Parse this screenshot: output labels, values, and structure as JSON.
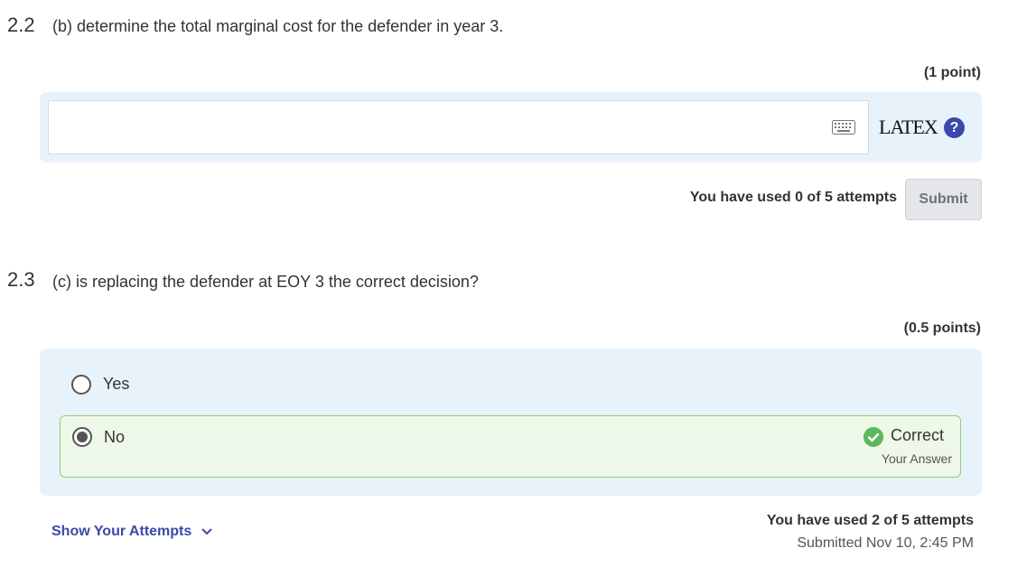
{
  "q22": {
    "number": "2.2",
    "text": "(b) determine the total marginal cost for the defender in year 3.",
    "points": "(1 point)",
    "input_value": "",
    "latex_label": "LATEX",
    "attempts_text": "You have used 0 of 5 attempts",
    "submit_label": "Submit"
  },
  "q23": {
    "number": "2.3",
    "text": "(c) is replacing the defender at EOY 3 the correct decision?",
    "points": "(0.5 points)",
    "options": [
      {
        "label": "Yes",
        "selected": false
      },
      {
        "label": "No",
        "selected": true
      }
    ],
    "result_label": "Correct",
    "result_sub": "Your Answer",
    "show_attempts_label": "Show Your Attempts",
    "attempts_text": "You have used 2 of 5 attempts",
    "submitted_text": "Submitted Nov 10, 2:45 PM"
  },
  "colors": {
    "panel_bg": "#e8f2fb",
    "correct_bg": "#eef8e8",
    "correct_border": "#8fcf6d",
    "check_green": "#5cb85c",
    "link_blue": "#3949ab"
  },
  "icons": {
    "keyboard": "keyboard-icon",
    "help": "help-icon",
    "check": "check-circle-icon",
    "chevron": "chevron-down-icon"
  }
}
